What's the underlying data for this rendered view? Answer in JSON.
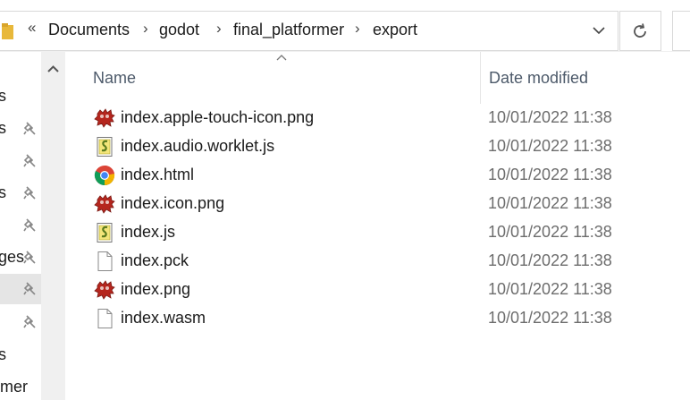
{
  "breadcrumb": {
    "overflow": "«",
    "items": [
      "Documents",
      "godot",
      "final_platformer",
      "export"
    ],
    "separator": "›"
  },
  "nav": {
    "items": [
      {
        "label": "s",
        "pinned": false,
        "selected": false
      },
      {
        "label": "s",
        "pinned": true,
        "selected": false
      },
      {
        "label": "",
        "pinned": true,
        "selected": false
      },
      {
        "label": "s",
        "pinned": true,
        "selected": false
      },
      {
        "label": "",
        "pinned": true,
        "selected": false
      },
      {
        "label": "ges",
        "pinned": true,
        "selected": false
      },
      {
        "label": "",
        "pinned": true,
        "selected": true
      },
      {
        "label": "",
        "pinned": true,
        "selected": false
      },
      {
        "label": "s",
        "pinned": false,
        "selected": false
      },
      {
        "label": "rmer",
        "pinned": false,
        "selected": false
      }
    ]
  },
  "columns": {
    "name": "Name",
    "date": "Date modified"
  },
  "files": [
    {
      "name": "index.apple-touch-icon.png",
      "date": "10/01/2022 11:38",
      "icon": "godot-icon"
    },
    {
      "name": "index.audio.worklet.js",
      "date": "10/01/2022 11:38",
      "icon": "script-icon"
    },
    {
      "name": "index.html",
      "date": "10/01/2022 11:38",
      "icon": "chrome-icon"
    },
    {
      "name": "index.icon.png",
      "date": "10/01/2022 11:38",
      "icon": "godot-icon"
    },
    {
      "name": "index.js",
      "date": "10/01/2022 11:38",
      "icon": "script-icon"
    },
    {
      "name": "index.pck",
      "date": "10/01/2022 11:38",
      "icon": "blank-file-icon"
    },
    {
      "name": "index.png",
      "date": "10/01/2022 11:38",
      "icon": "godot-icon"
    },
    {
      "name": "index.wasm",
      "date": "10/01/2022 11:38",
      "icon": "blank-file-icon"
    }
  ],
  "colors": {
    "header_text": "#4d5a6a",
    "date_text": "#6d6d6d",
    "selected_bg": "#e5e5e5",
    "godot_red": "#b5261e"
  }
}
